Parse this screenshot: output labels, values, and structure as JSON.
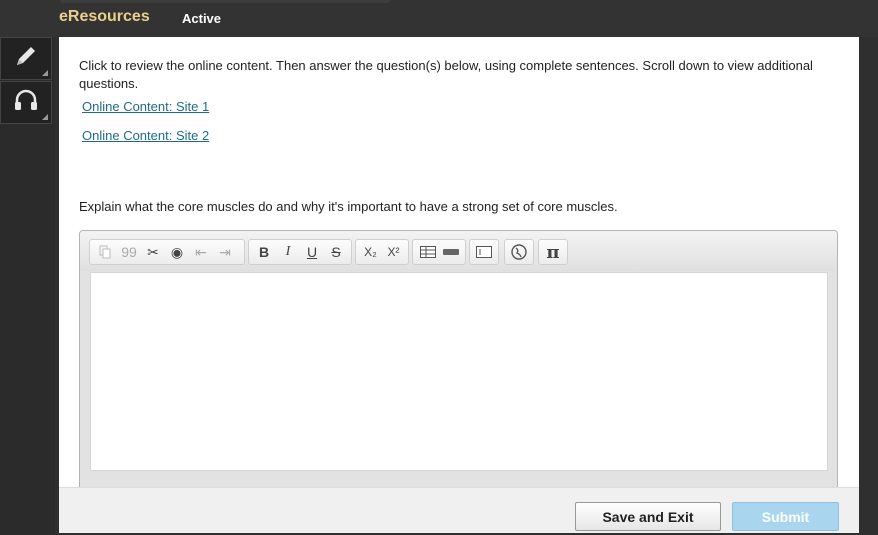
{
  "header": {
    "brand": "eResources",
    "status": "Active"
  },
  "sidebar": {
    "items": [
      {
        "icon": "pencil-icon"
      },
      {
        "icon": "headphones-icon"
      }
    ]
  },
  "main": {
    "instructions": "Click to review the online content. Then answer the question(s) below, using complete sentences. Scroll down to view additional questions.",
    "links": [
      {
        "label": "Online Content: Site 1"
      },
      {
        "label": "Online Content: Site 2"
      }
    ],
    "question": "Explain what the core muscles do and why it's important to have a strong set of core muscles."
  },
  "editor": {
    "toolbar": {
      "copy": "copy-icon",
      "quote": "99",
      "cut": "cut-icon",
      "record": "record-icon",
      "indent_decrease": "outdent-icon",
      "indent_increase": "indent-icon",
      "bold": "B",
      "italic": "I",
      "underline": "U",
      "strike": "S",
      "subscript": "X₂",
      "superscript": "X²",
      "table": "table-icon",
      "hr": "line-icon",
      "field": "text-field-icon",
      "globe": "globe-icon",
      "pi": "π"
    },
    "value": ""
  },
  "footer": {
    "save_label": "Save and Exit",
    "submit_label": "Submit"
  }
}
